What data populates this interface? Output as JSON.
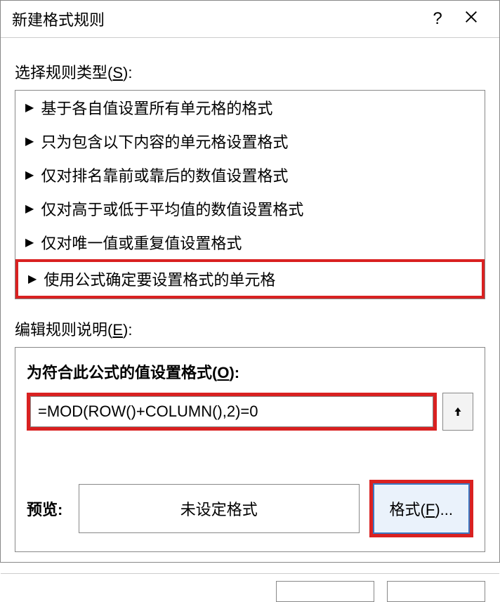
{
  "titlebar": {
    "title": "新建格式规则",
    "help": "?",
    "close_aria": "关闭"
  },
  "ruleTypeLabel": {
    "prefix": "选择规则类型(",
    "key": "S",
    "suffix": "):"
  },
  "ruleItems": [
    "基于各自值设置所有单元格的格式",
    "只为包含以下内容的单元格设置格式",
    "仅对排名靠前或靠后的数值设置格式",
    "仅对高于或低于平均值的数值设置格式",
    "仅对唯一值或重复值设置格式",
    "使用公式确定要设置格式的单元格"
  ],
  "editLabel": {
    "prefix": "编辑规则说明(",
    "key": "E",
    "suffix": "):"
  },
  "formulaLabel": {
    "prefix": "为符合此公式的值设置格式(",
    "key": "O",
    "suffix": "):"
  },
  "formulaValue": "=MOD(ROW()+COLUMN(),2)=0",
  "previewLabel": "预览:",
  "previewText": "未设定格式",
  "formatBtn": {
    "prefix": "格式(",
    "key": "F",
    "suffix": ")..."
  }
}
